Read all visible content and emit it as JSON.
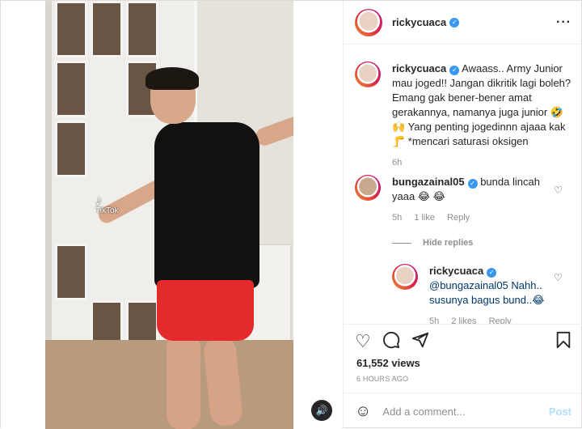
{
  "post": {
    "username": "rickycuaca",
    "caption_user": "rickycuaca",
    "caption_text": "Awaass.. Army Junior mau joged!! Jangan dikritik lagi boleh? Emang gak bener-bener amat gerakannya, namanya juga junior 🤣 🙌 Yang penting jogedinnn ajaaa kak 🦵 *mencari saturasi oksigen",
    "caption_time": "6h"
  },
  "comments": [
    {
      "username": "bungazainal05",
      "text": "bunda lincah yaaa 😂 😂",
      "time": "5h",
      "likes": "1 like",
      "reply": "Reply"
    }
  ],
  "hide_replies": "Hide replies",
  "reply": {
    "username": "rickycuaca",
    "text": "@bungazainal05 Nahh.. susunya bagus bund..😂",
    "time": "5h",
    "likes": "2 likes",
    "reply": "Reply"
  },
  "video": {
    "watermark": "TikTok"
  },
  "stats": {
    "views": "61,552 views",
    "posted": "6 HOURS AGO"
  },
  "add_comment": {
    "placeholder": "Add a comment...",
    "post_label": "Post"
  },
  "icons": {
    "heart": "heart-icon",
    "comment": "comment-icon",
    "share": "share-icon",
    "bookmark": "bookmark-icon",
    "more": "more-icon",
    "sound": "sound-icon",
    "emoji": "emoji-icon"
  },
  "colors": {
    "verified": "#3897f0",
    "post_button": "#b2dffc",
    "muted": "#8e8e8e"
  }
}
